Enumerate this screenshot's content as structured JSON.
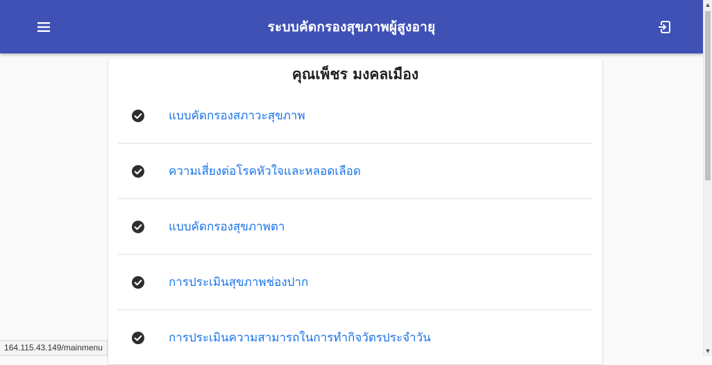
{
  "app_bar": {
    "title": "ระบบคัดกรองสุขภาพผู้สูงอายุ",
    "menu_icon": "hamburger-menu-icon",
    "logout_icon": "logout-icon",
    "color": "#3f51b5"
  },
  "card": {
    "user_name": "คุณเพ็ชร มงคลเมือง"
  },
  "menu_items": [
    {
      "label": "แบบคัดกรองสภาวะสุขภาพ",
      "icon": "check-circle-icon",
      "completed": true
    },
    {
      "label": "ความเสี่ยงต่อโรคหัวใจและหลอดเลือด",
      "icon": "check-circle-icon",
      "completed": true
    },
    {
      "label": "แบบคัดกรองสุขภาพตา",
      "icon": "check-circle-icon",
      "completed": true
    },
    {
      "label": "การประเมินสุขภาพช่องปาก",
      "icon": "check-circle-icon",
      "completed": true
    },
    {
      "label": "การประเมินความสามารถในการทำกิจวัตรประจำวัน",
      "icon": "check-circle-icon",
      "completed": true
    }
  ],
  "colors": {
    "link": "#1a73e8",
    "check": "#2e2e2e"
  },
  "status_bar": {
    "url": "164.115.43.149/mainmenu"
  }
}
